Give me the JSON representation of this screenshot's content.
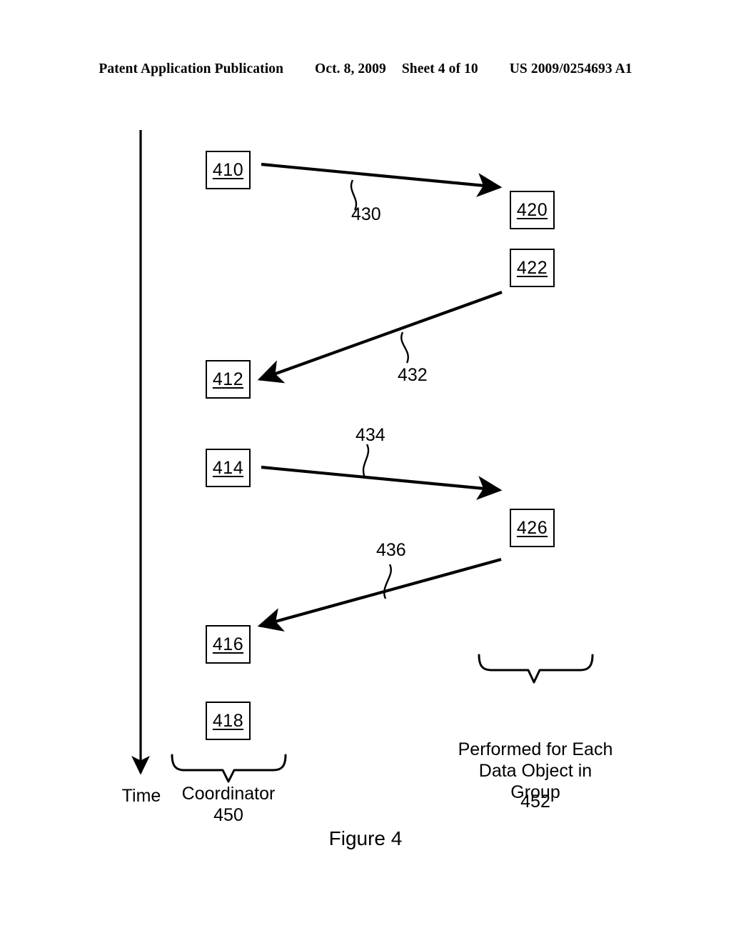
{
  "header": {
    "publication": "Patent Application Publication",
    "date": "Oct. 8, 2009",
    "sheet": "Sheet 4 of 10",
    "patent_number": "US 2009/0254693 A1"
  },
  "figure": {
    "caption": "Figure 4",
    "time_axis_label": "Time",
    "coordinator_group": {
      "label": "Coordinator",
      "reference": "450"
    },
    "each_object_group": {
      "label": "Performed for Each\nData Object in\nGroup",
      "reference": "452"
    },
    "coordinator_nodes": [
      {
        "id": "410",
        "label": "410"
      },
      {
        "id": "412",
        "label": "412"
      },
      {
        "id": "414",
        "label": "414"
      },
      {
        "id": "416",
        "label": "416"
      },
      {
        "id": "418",
        "label": "418"
      }
    ],
    "object_nodes": [
      {
        "id": "420",
        "label": "420"
      },
      {
        "id": "422",
        "label": "422"
      },
      {
        "id": "426",
        "label": "426"
      }
    ],
    "messages": [
      {
        "id": "430",
        "label": "430",
        "from": "410",
        "to": "420",
        "direction": "right"
      },
      {
        "id": "432",
        "label": "432",
        "from": "422",
        "to": "412",
        "direction": "left"
      },
      {
        "id": "434",
        "label": "434",
        "from": "414",
        "to": "426",
        "direction": "right"
      },
      {
        "id": "436",
        "label": "436",
        "from": "426",
        "to": "416",
        "direction": "left"
      }
    ],
    "colors": {
      "ink": "#000000",
      "paper": "#ffffff"
    }
  }
}
